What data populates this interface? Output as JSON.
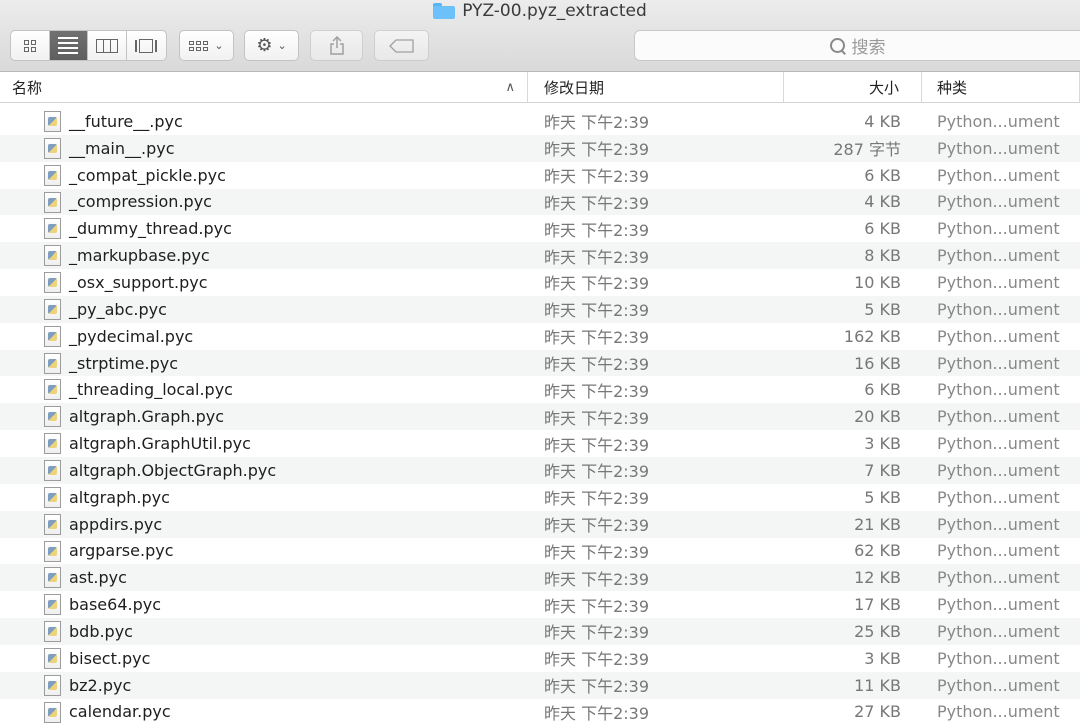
{
  "window": {
    "title": "PYZ-00.pyz_extracted"
  },
  "toolbar": {
    "view_icons": [
      "icon-view-icon",
      "list-view-icon",
      "column-view-icon",
      "cover-flow-icon"
    ],
    "search_placeholder": "搜索"
  },
  "columns": {
    "name": "名称",
    "date": "修改日期",
    "size": "大小",
    "kind": "种类"
  },
  "files": [
    {
      "name": "__future__.pyc",
      "date": "昨天 下午2:39",
      "size": "4 KB",
      "kind": "Python...ument"
    },
    {
      "name": "__main__.pyc",
      "date": "昨天 下午2:39",
      "size": "287 字节",
      "kind": "Python...ument"
    },
    {
      "name": "_compat_pickle.pyc",
      "date": "昨天 下午2:39",
      "size": "6 KB",
      "kind": "Python...ument"
    },
    {
      "name": "_compression.pyc",
      "date": "昨天 下午2:39",
      "size": "4 KB",
      "kind": "Python...ument"
    },
    {
      "name": "_dummy_thread.pyc",
      "date": "昨天 下午2:39",
      "size": "6 KB",
      "kind": "Python...ument"
    },
    {
      "name": "_markupbase.pyc",
      "date": "昨天 下午2:39",
      "size": "8 KB",
      "kind": "Python...ument"
    },
    {
      "name": "_osx_support.pyc",
      "date": "昨天 下午2:39",
      "size": "10 KB",
      "kind": "Python...ument"
    },
    {
      "name": "_py_abc.pyc",
      "date": "昨天 下午2:39",
      "size": "5 KB",
      "kind": "Python...ument"
    },
    {
      "name": "_pydecimal.pyc",
      "date": "昨天 下午2:39",
      "size": "162 KB",
      "kind": "Python...ument"
    },
    {
      "name": "_strptime.pyc",
      "date": "昨天 下午2:39",
      "size": "16 KB",
      "kind": "Python...ument"
    },
    {
      "name": "_threading_local.pyc",
      "date": "昨天 下午2:39",
      "size": "6 KB",
      "kind": "Python...ument"
    },
    {
      "name": "altgraph.Graph.pyc",
      "date": "昨天 下午2:39",
      "size": "20 KB",
      "kind": "Python...ument"
    },
    {
      "name": "altgraph.GraphUtil.pyc",
      "date": "昨天 下午2:39",
      "size": "3 KB",
      "kind": "Python...ument"
    },
    {
      "name": "altgraph.ObjectGraph.pyc",
      "date": "昨天 下午2:39",
      "size": "7 KB",
      "kind": "Python...ument"
    },
    {
      "name": "altgraph.pyc",
      "date": "昨天 下午2:39",
      "size": "5 KB",
      "kind": "Python...ument"
    },
    {
      "name": "appdirs.pyc",
      "date": "昨天 下午2:39",
      "size": "21 KB",
      "kind": "Python...ument"
    },
    {
      "name": "argparse.pyc",
      "date": "昨天 下午2:39",
      "size": "62 KB",
      "kind": "Python...ument"
    },
    {
      "name": "ast.pyc",
      "date": "昨天 下午2:39",
      "size": "12 KB",
      "kind": "Python...ument"
    },
    {
      "name": "base64.pyc",
      "date": "昨天 下午2:39",
      "size": "17 KB",
      "kind": "Python...ument"
    },
    {
      "name": "bdb.pyc",
      "date": "昨天 下午2:39",
      "size": "25 KB",
      "kind": "Python...ument"
    },
    {
      "name": "bisect.pyc",
      "date": "昨天 下午2:39",
      "size": "3 KB",
      "kind": "Python...ument"
    },
    {
      "name": "bz2.pyc",
      "date": "昨天 下午2:39",
      "size": "11 KB",
      "kind": "Python...ument"
    },
    {
      "name": "calendar.pyc",
      "date": "昨天 下午2:39",
      "size": "27 KB",
      "kind": "Python...ument"
    }
  ]
}
